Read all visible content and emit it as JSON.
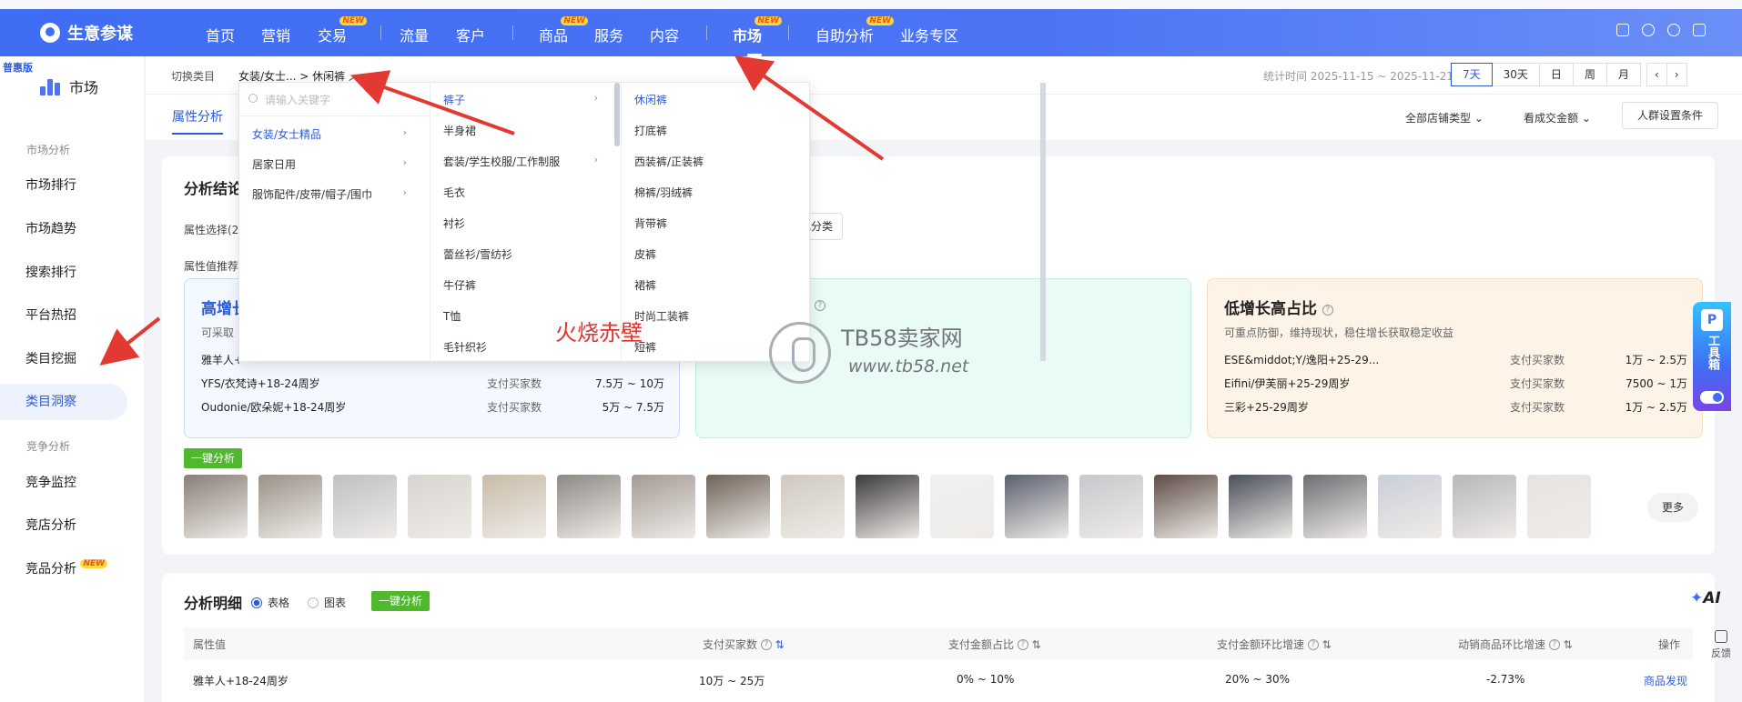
{
  "topbar": {
    "logo": "生意参谋",
    "nav": [
      {
        "label": "首页",
        "new": false
      },
      {
        "label": "营销",
        "new": false
      },
      {
        "label": "交易",
        "new": true
      },
      {
        "label": "流量",
        "new": false
      },
      {
        "label": "客户",
        "new": false
      },
      {
        "label": "商品",
        "new": true
      },
      {
        "label": "服务",
        "new": false
      },
      {
        "label": "内容",
        "new": false
      },
      {
        "label": "市场",
        "new": true,
        "active": true
      },
      {
        "label": "自助分析",
        "new": true
      },
      {
        "label": "业务专区",
        "new": false
      }
    ],
    "new_badge": "NEW"
  },
  "sidebar": {
    "edition": "普惠版",
    "title": "市场",
    "group_market": "市场分析",
    "market_items": [
      "市场排行",
      "市场趋势",
      "搜索排行",
      "平台热招",
      "类目挖掘",
      "类目洞察"
    ],
    "active_item": "类目洞察",
    "group_compete": "竞争分析",
    "compete_items": [
      "竞争监控",
      "竞店分析",
      "竞品分析"
    ]
  },
  "subbar": {
    "switch_label": "切换类目",
    "path": "女装/女士... > 休闲裤",
    "stat_time": "统计时间 2025-11-15 ~ 2025-11-21",
    "ranges": [
      "7天",
      "30天",
      "日",
      "周",
      "月"
    ],
    "active_range": "7天",
    "prev": "‹",
    "next": "›"
  },
  "tabbar": {
    "tab": "属性分析",
    "filters": [
      "全部店铺类型",
      "看成交金额"
    ],
    "crowd_button": "人群设置条件"
  },
  "analysis": {
    "title": "分析结论",
    "attr_select": "属性选择(2,",
    "attr_recommend": "属性值推荐",
    "color_tag": "色分类",
    "panels": [
      {
        "title": "高增长",
        "sub": "可采取",
        "rows": [
          {
            "name": "雅羊人+",
            "label": "",
            "value": ""
          },
          {
            "name": "YFS/衣梵诗+18-24周岁",
            "label": "支付买家数",
            "value": "7.5万 ~ 10万"
          },
          {
            "name": "Oudonie/欧朵妮+18-24周岁",
            "label": "支付买家数",
            "value": "5万 ~ 7.5万"
          }
        ]
      },
      {
        "title": "",
        "sub": "",
        "rows": []
      },
      {
        "title": "低增长高占比",
        "sub": "可重点防御，维持现状，稳住增长获取稳定收益",
        "rows": [
          {
            "name": "ESE&middot;Y/逸阳+25-29...",
            "label": "支付买家数",
            "value": "1万 ~ 2.5万"
          },
          {
            "name": "Eifini/伊芙丽+25-29周岁",
            "label": "支付买家数",
            "value": "7500 ~ 1万"
          },
          {
            "name": "三彩+25-29周岁",
            "label": "支付买家数",
            "value": "1万 ~ 2.5万"
          }
        ]
      }
    ],
    "one_click": "一键分析",
    "more": "更多",
    "thumb_colors": [
      "#8a7f78",
      "#9a9288",
      "#bfc0c2",
      "#d8d4cf",
      "#c9bba9",
      "#8d8a86",
      "#a39a94",
      "#6f6258",
      "#cfc9c0",
      "#3c3a3b",
      "#f0f0f0",
      "#5b6070",
      "#c6c8cc",
      "#5e4c46",
      "#4a4f5a",
      "#6d6e73",
      "#c9cfd8",
      "#b7b7bb",
      "#e6e4e1"
    ]
  },
  "detail": {
    "title": "分析明细",
    "view_table": "表格",
    "view_chart": "图表",
    "one_click": "一键分析",
    "columns": [
      "属性值",
      "支付买家数",
      "支付金额占比",
      "支付金额环比增速",
      "动销商品环比增速",
      "操作"
    ],
    "rows": [
      {
        "attr": "雅羊人+18-24周岁",
        "buyers": "10万 ~ 25万",
        "share": "0% ~ 10%",
        "growth": "20% ~ 30%",
        "active_growth": "-2.73%",
        "action": "商品发现"
      }
    ]
  },
  "dropdown": {
    "search_placeholder": "请输入关键字",
    "level1": [
      "女装/女士精品",
      "居家日用",
      "服饰配件/皮带/帽子/围巾"
    ],
    "level1_selected": "女装/女士精品",
    "level2": [
      "裤子",
      "半身裙",
      "套装/学生校服/工作制服",
      "毛衣",
      "衬衫",
      "蕾丝衫/雪纺衫",
      "牛仔裤",
      "T恤",
      "毛针织衫"
    ],
    "level2_selected": "裤子",
    "level3": [
      "休闲裤",
      "打底裤",
      "西装裤/正装裤",
      "棉裤/羽绒裤",
      "背带裤",
      "皮裤",
      "裙裤",
      "时尚工装裤",
      "短裤"
    ],
    "level3_selected": "休闲裤"
  },
  "tools": {
    "toolbox": "工具箱",
    "ai": "AI",
    "feedback": "反馈"
  },
  "watermark": {
    "cn": "火烧赤壁",
    "site": "TB58卖家网",
    "url": "www.tb58.net"
  }
}
